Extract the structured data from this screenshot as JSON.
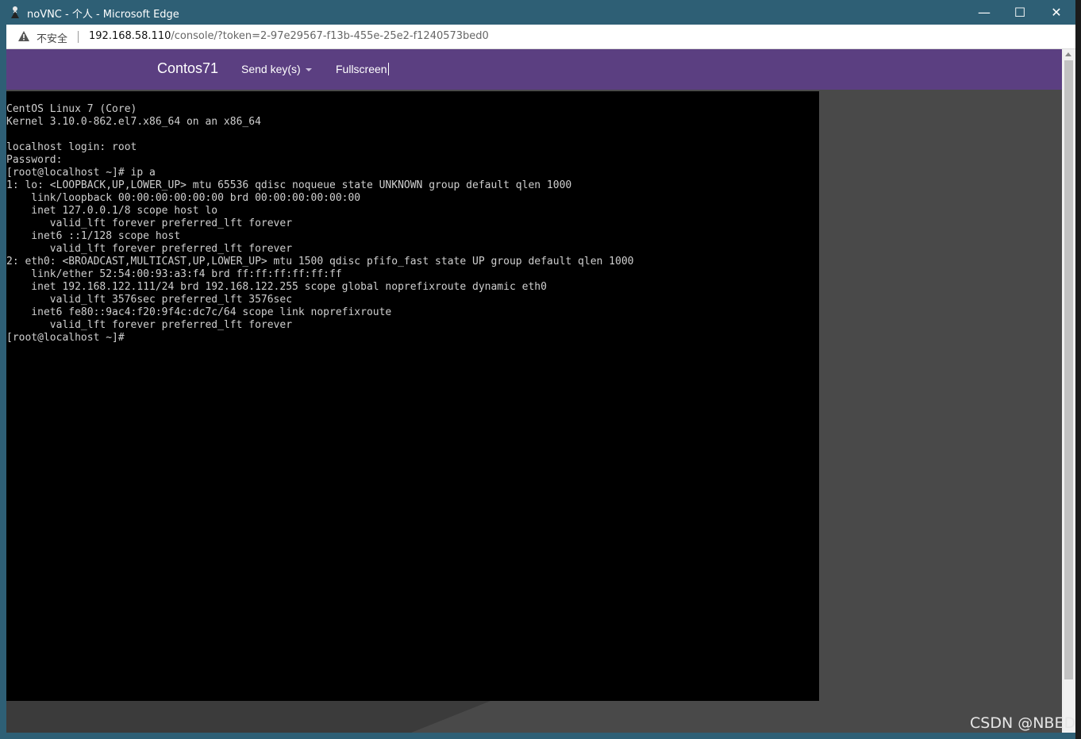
{
  "window": {
    "title": "noVNC - 个人 - Microsoft Edge",
    "minimize_glyph": "—",
    "maximize_glyph": "☐",
    "close_glyph": "✕"
  },
  "addressbar": {
    "security_label": "不安全",
    "url_host": "192.168.58.110",
    "url_path": "/console/?token=2-97e29567-f13b-455e-25e2-f1240573bed0"
  },
  "novnc": {
    "brand": "Contos71",
    "send_keys_label": "Send key(s)",
    "fullscreen_label": "Fullscreen",
    "nav_color": "#5b3f81"
  },
  "console": {
    "lines": [
      "CentOS Linux 7 (Core)",
      "Kernel 3.10.0-862.el7.x86_64 on an x86_64",
      "",
      "localhost login: root",
      "Password:",
      "[root@localhost ~]# ip a",
      "1: lo: <LOOPBACK,UP,LOWER_UP> mtu 65536 qdisc noqueue state UNKNOWN group default qlen 1000",
      "    link/loopback 00:00:00:00:00:00 brd 00:00:00:00:00:00",
      "    inet 127.0.0.1/8 scope host lo",
      "       valid_lft forever preferred_lft forever",
      "    inet6 ::1/128 scope host",
      "       valid_lft forever preferred_lft forever",
      "2: eth0: <BROADCAST,MULTICAST,UP,LOWER_UP> mtu 1500 qdisc pfifo_fast state UP group default qlen 1000",
      "    link/ether 52:54:00:93:a3:f4 brd ff:ff:ff:ff:ff:ff",
      "    inet 192.168.122.111/24 brd 192.168.122.255 scope global noprefixroute dynamic eth0",
      "       valid_lft 3576sec preferred_lft 3576sec",
      "    inet6 fe80::9ac4:f20:9f4c:dc7c/64 scope link noprefixroute",
      "       valid_lft forever preferred_lft forever",
      "[root@localhost ~]#"
    ]
  },
  "watermark": "CSDN @NBED",
  "icons": {
    "app": "novnc-app-icon",
    "warning": "warning-triangle-icon",
    "caret": "caret-down-icon"
  }
}
